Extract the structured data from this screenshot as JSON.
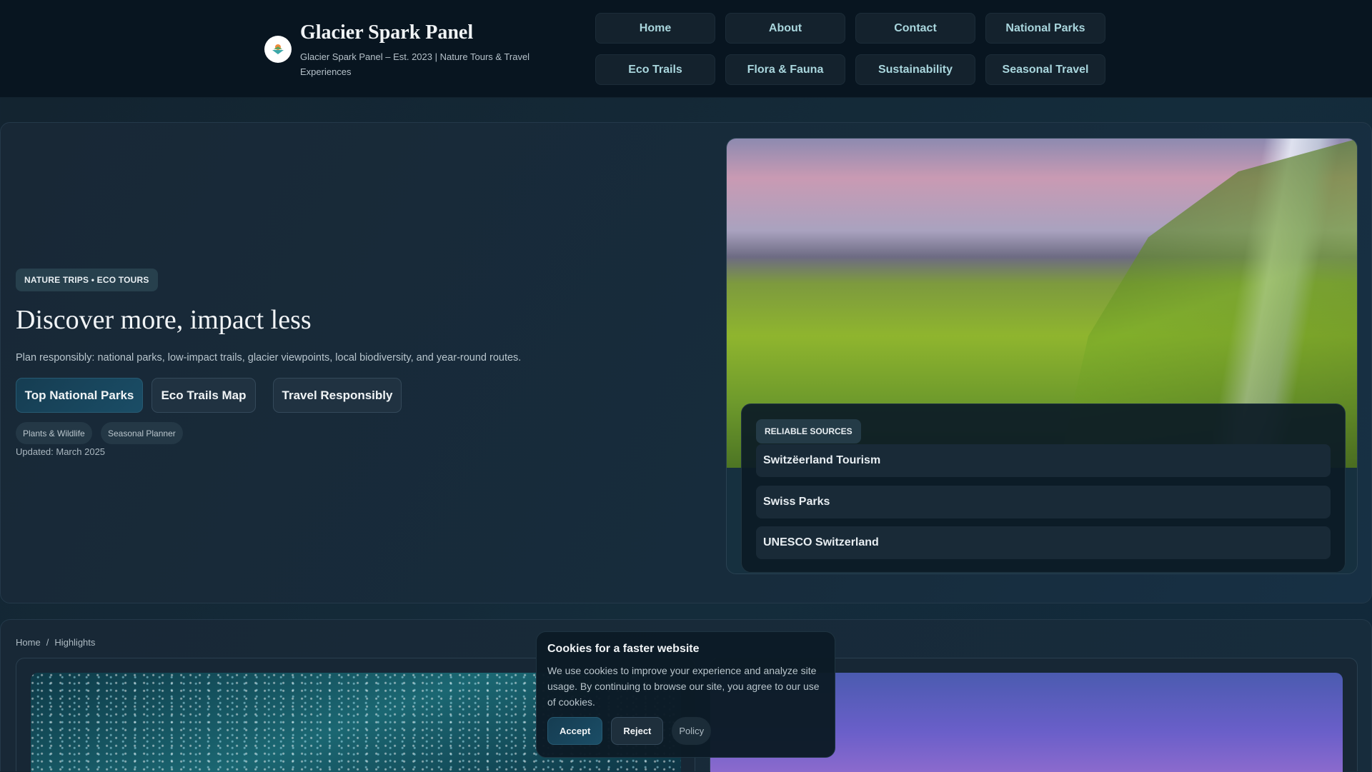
{
  "header": {
    "title": "Glacier Spark Panel",
    "subtitle": "Glacier Spark Panel – Est. 2023 | Nature Tours & Travel Experiences",
    "nav": [
      "Home",
      "About",
      "Contact",
      "National Parks",
      "Eco Trails",
      "Flora & Fauna",
      "Sustainability",
      "Seasonal Travel"
    ]
  },
  "hero": {
    "badge": "NATURE TRIPS • ECO TOURS",
    "title": "Discover more, impact less",
    "lead": "Plan responsibly: national parks, low-impact trails, glacier viewpoints, local biodiversity, and year-round routes.",
    "buttons": [
      "Top National Parks",
      "Eco Trails Map",
      "Travel Responsibly"
    ],
    "chips": [
      "Plants & Wildlife",
      "Seasonal Planner"
    ],
    "updated": "Updated: March 2025"
  },
  "sources": {
    "badge": "RELIABLE SOURCES",
    "items": [
      "Switzëerland Tourism",
      "Swiss Parks",
      "UNESCO Switzerland"
    ]
  },
  "breadcrumb": {
    "home": "Home",
    "sep": "/",
    "current": "Highlights"
  },
  "cookie": {
    "title": "Cookies for a faster website",
    "text": "We use cookies to improve your experience and analyze site usage. By continuing to browse our site, you agree to our use of cookies.",
    "accept": "Accept",
    "reject": "Reject",
    "policy": "Policy"
  }
}
